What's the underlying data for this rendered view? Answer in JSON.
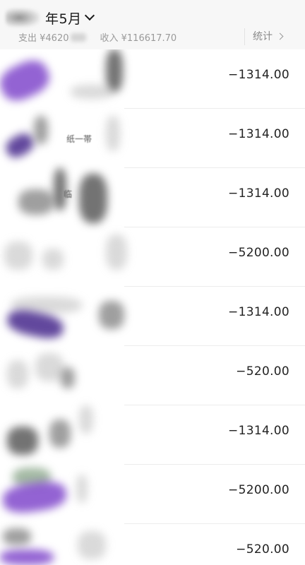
{
  "header": {
    "month_label": "年5月",
    "summary": {
      "expense_prefix": "支出 ¥4620",
      "income_label": "收入 ¥116617.70"
    },
    "stats_label": "统计"
  },
  "transactions": [
    {
      "amount": "−1314.00"
    },
    {
      "amount": "−1314.00",
      "merchant_fragment": "纸一帯"
    },
    {
      "amount": "−1314.00",
      "merchant_fragment": "临"
    },
    {
      "amount": "−5200.00"
    },
    {
      "amount": "−1314.00"
    },
    {
      "amount": "−520.00"
    },
    {
      "amount": "−1314.00"
    },
    {
      "amount": "−5200.00"
    },
    {
      "amount": "−520.00"
    }
  ],
  "colors": {
    "header_bg": "#f7f7f7",
    "amount_text": "#222222",
    "muted_text": "#9a9a9a",
    "blur_accent": "#7a3fd0"
  },
  "icons": {
    "month_dropdown": "chevron-down-icon",
    "stats": "chevron-right-icon"
  }
}
